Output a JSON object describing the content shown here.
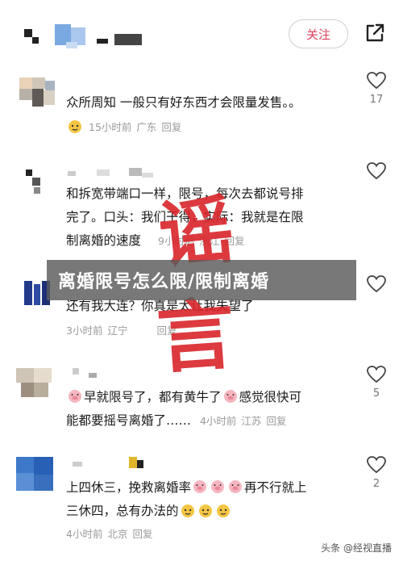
{
  "header": {
    "follow_label": "关注"
  },
  "banner_title": "离婚限号怎么限/限制离婚",
  "stamp_text": "谣言",
  "comments": [
    {
      "lines": [
        "众所周知 一般只有好东西才会限量发售。。"
      ],
      "time": "15小时前",
      "location": "广东",
      "reply": "回复",
      "likes": "17"
    },
    {
      "lines": [
        "和拆宽带端口一样，限号，每次去都说号排",
        "完了。口头：我们干得，实际：我就是在限",
        "制离婚的速度"
      ],
      "time": "9小时前",
      "location": "浙江",
      "reply": "回复",
      "likes": ""
    },
    {
      "lines": [
        "还有我大连？你真是太让我失望了"
      ],
      "time": "3小时前",
      "location": "辽宁",
      "reply": "回复",
      "likes": ""
    },
    {
      "lines": [
        "早就限号了，都有黄牛了",
        "感觉很快可",
        "能都要摇号离婚了……"
      ],
      "time": "4小时前",
      "location": "江苏",
      "reply": "回复",
      "likes": "5"
    },
    {
      "lines": [
        "上四休三，挽救离婚率",
        "再不行就上",
        "三休四，总有办法的"
      ],
      "time": "4小时前",
      "location": "北京",
      "reply": "回复",
      "likes": "2"
    }
  ],
  "watermark": "头条 @经视直播",
  "colors": {
    "accent": "#e0425c",
    "stamp": "#d9252b",
    "banner": "#5a5a5a"
  },
  "icons": [
    "share-icon",
    "heart-icon",
    "emoji-face-icon",
    "emoji-pig-icon"
  ]
}
